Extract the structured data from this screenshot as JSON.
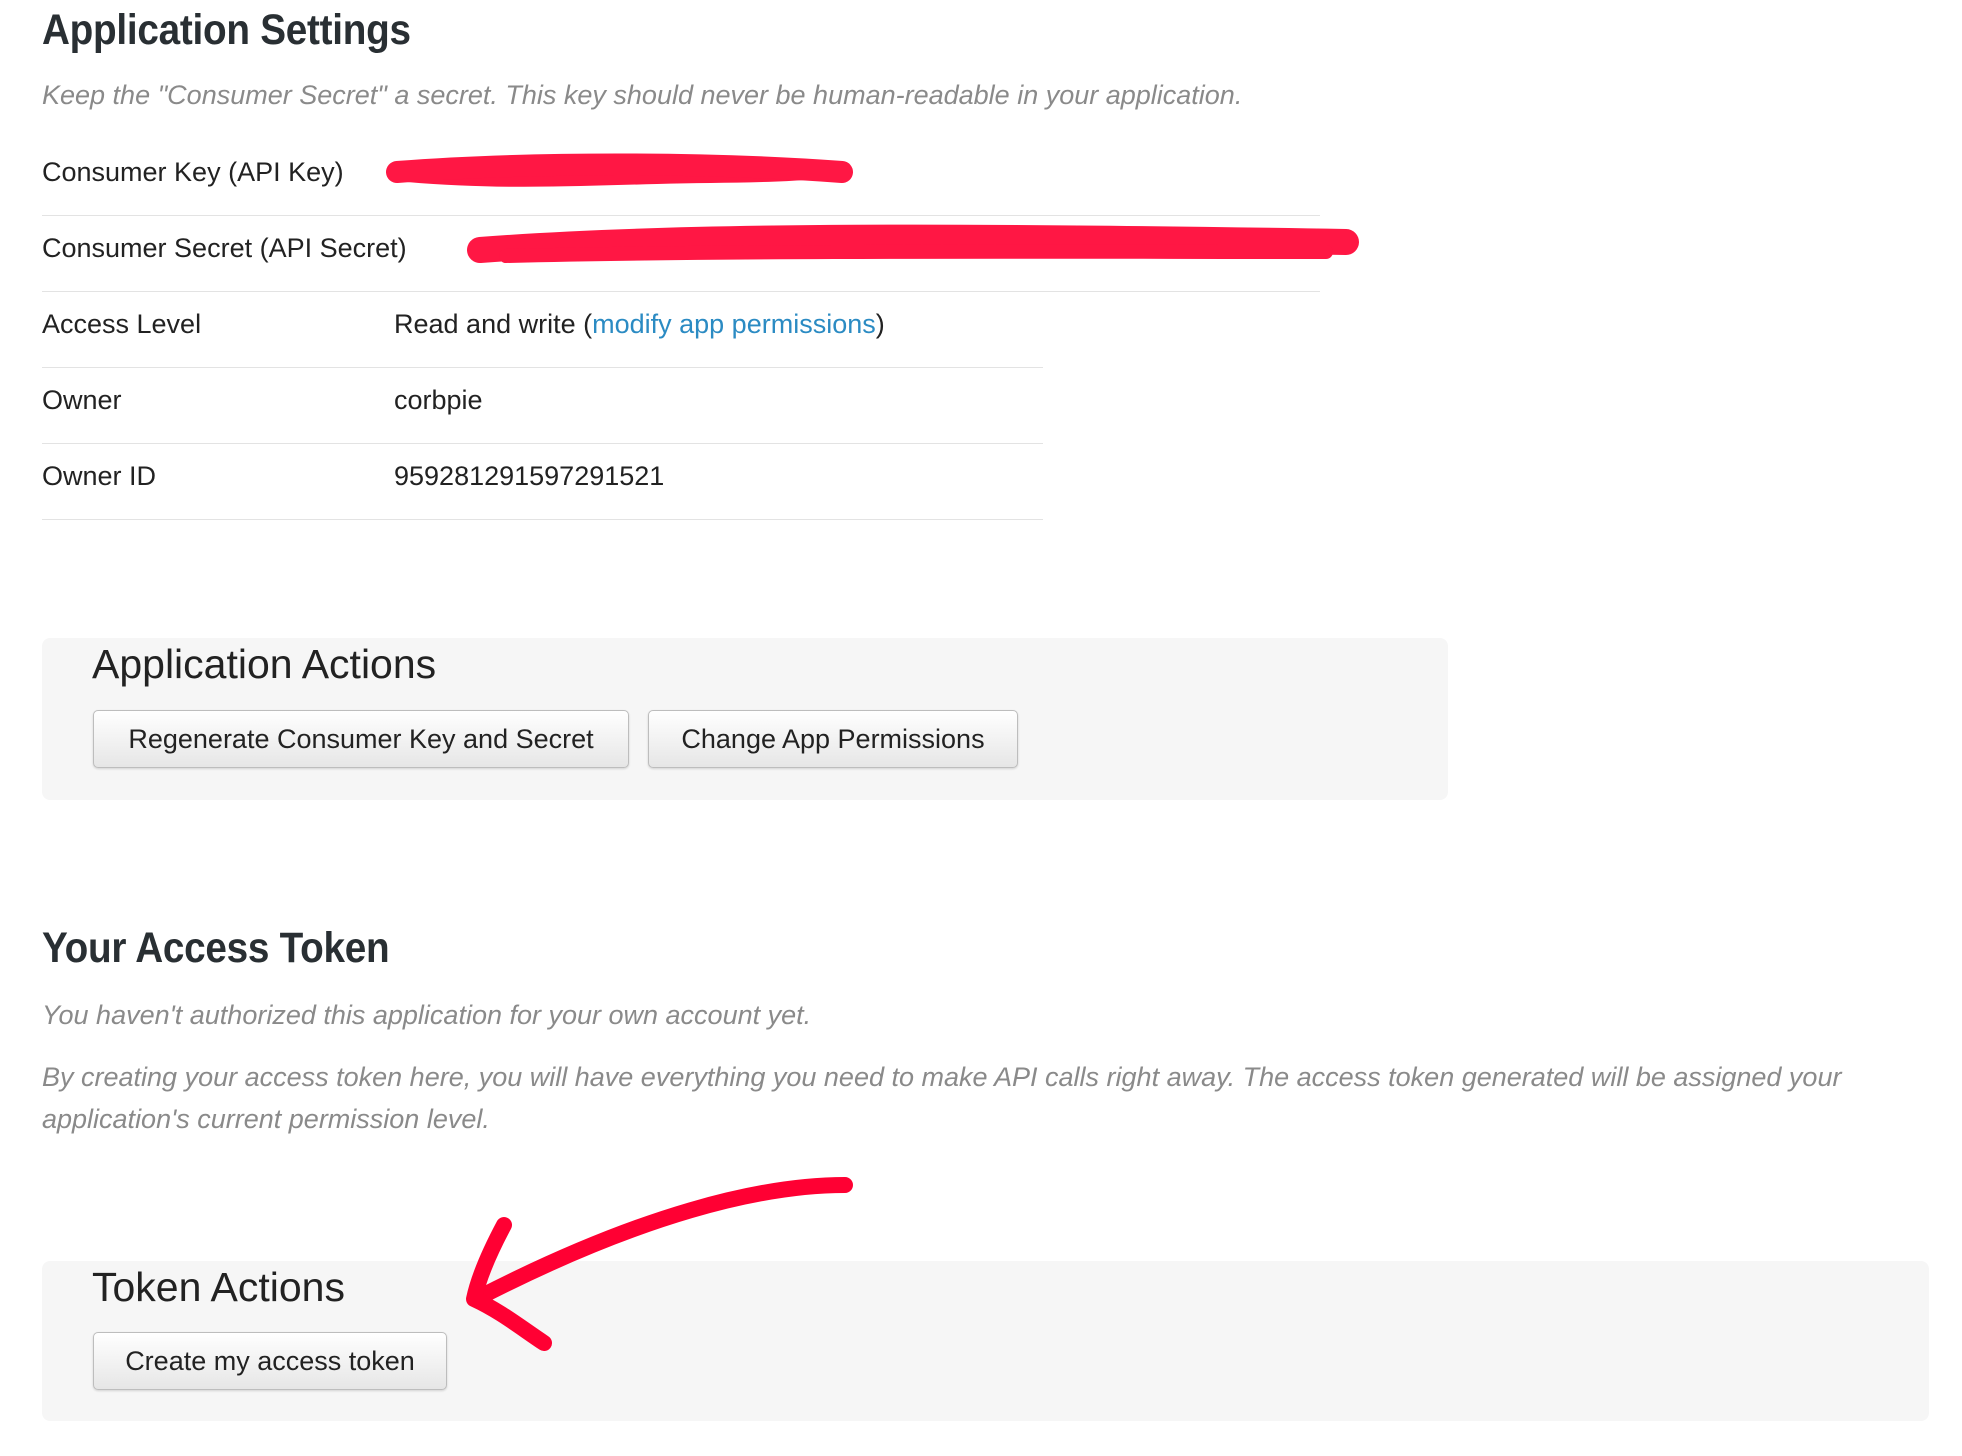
{
  "app_settings": {
    "title": "Application Settings",
    "hint": "Keep the \"Consumer Secret\" a secret. This key should never be human-readable in your application.",
    "rows": [
      {
        "label": "Consumer Key (API Key)",
        "value": ""
      },
      {
        "label": "Consumer Secret (API Secret)",
        "value": ""
      },
      {
        "label": "Access Level",
        "value_prefix": "Read and write (",
        "link": "modify app permissions",
        "value_suffix": ")"
      },
      {
        "label": "Owner",
        "value": "corbpie"
      },
      {
        "label": "Owner ID",
        "value": "959281291597291521"
      }
    ]
  },
  "app_actions": {
    "title": "Application Actions",
    "regenerate_label": "Regenerate Consumer Key and Secret",
    "change_permissions_label": "Change App Permissions"
  },
  "access_token": {
    "title": "Your Access Token",
    "hint1": "You haven't authorized this application for your own account yet.",
    "hint2": "By creating your access token here, you will have everything you need to make API calls right away. The access token generated will be assigned your application's current permission level."
  },
  "token_actions": {
    "title": "Token Actions",
    "create_label": "Create my access token"
  },
  "colors": {
    "link": "#2b8bc3",
    "annotation": "#ff0033",
    "panel_bg": "#f6f6f6",
    "hint_text": "#8a8a8a"
  },
  "icons": {
    "annotation": "red-arrow-icon"
  }
}
